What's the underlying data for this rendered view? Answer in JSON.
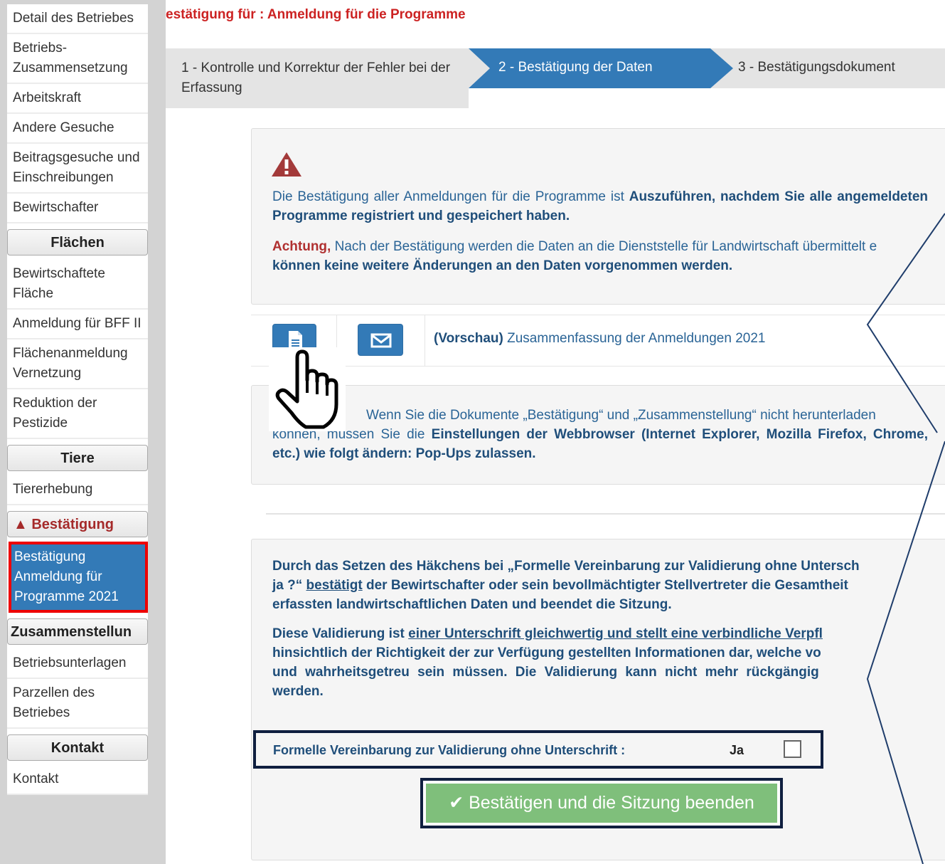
{
  "sidebar": {
    "items_top": [
      {
        "name": "nav-detail-des-betriebes",
        "label": "Detail des Betriebes"
      },
      {
        "name": "nav-betriebs-zusammensetzung",
        "label": "Betriebs-Zusammensetzung"
      },
      {
        "name": "nav-arbeitskraft",
        "label": "Arbeitskraft"
      },
      {
        "name": "nav-andere-gesuche",
        "label": "Andere Gesuche"
      },
      {
        "name": "nav-beitragsgesuche",
        "label": "Beitragsgesuche und Einschreibungen"
      },
      {
        "name": "nav-bewirtschafter",
        "label": "Bewirtschafter"
      }
    ],
    "section_flaechen": "Flächen",
    "items_flaechen": [
      {
        "name": "nav-bewirtschaftete-flaeche",
        "label": "Bewirtschaftete Fläche"
      },
      {
        "name": "nav-anmeldung-bff",
        "label": "Anmeldung für BFF II"
      },
      {
        "name": "nav-flaechenanmeldung",
        "label": "Flächenanmeldung Vernetzung"
      },
      {
        "name": "nav-reduktion-pestizide",
        "label": "Reduktion der Pestizide"
      }
    ],
    "section_tiere": "Tiere",
    "item_tiererhebung": "Tiererhebung",
    "section_bestaetigung": "Bestätigung",
    "item_active": "Bestätigung Anmeldung für Programme 2021",
    "section_zusammenstellung": "Zusammenstellun",
    "item_betriebsunterlagen": "Betriebsunterlagen",
    "item_parzellen": "Parzellen des Betriebes",
    "section_kontakt": "Kontakt",
    "item_kontakt": "Kontakt"
  },
  "header": {
    "title": "estätigung für : Anmeldung für die Programme"
  },
  "steps": {
    "step1": "1 - Kontrolle und Korrektur der Fehler bei der Erfassung",
    "step2": "2 - Bestätigung der Daten",
    "step3": "3 - Bestätigungsdokument"
  },
  "info": {
    "line1_normal": "Die Bestätigung aller Anmeldungen für die Programme ist ",
    "line1_bold": "Auszuführen, nachdem Sie alle angemeldeten Programme registriert und gespeichert haben.",
    "achtung": "Achtung,",
    "line2_normal": " Nach der Bestätigung werden die Daten an die Dienststelle für Landwirtschaft übermittelt e",
    "line2_bold": "können keine weitere Änderungen an den Daten vorgenommen werden."
  },
  "docs": {
    "preview_label": "(Vorschau)",
    "summary_label": " Zusammenfassung der Anmeldungen 2021"
  },
  "popup": {
    "text_normal": "Wenn Sie die Dokumente „Bestätigung“ und „Zusammenstellung“ nicht herunterladen",
    "text_line2_start": "können, müssen Sie die ",
    "text_bold": "Einstellungen der Webbrowser (Internet Explorer, Mozilla Firefox, Chrome, etc.) wie folgt ändern: Pop-Ups zulassen."
  },
  "validation": {
    "p1_a": "Durch das Setzen des Häkchens bei „Formelle Vereinbarung zur Validierung ohne Untersch",
    "p1_b": "ja ?“ ",
    "p1_underline": "bestätigt",
    "p1_c": " der Bewirtschafter oder sein bevollmächtigter Stellvertreter die Gesamtheit",
    "p1_d": "erfassten landwirtschaftlichen Daten und beendet die Sitzung.",
    "p2_a": "Diese Validierung ist ",
    "p2_underline": "einer Unterschrift gleichwertig und stellt eine verbindliche Verpfl",
    "p2_b": "hinsichtlich der Richtigkeit der zur Verfügung gestellten Informationen dar, welche vo",
    "p2_c": "und wahrheitsgetreu sein müssen. Die Validierung kann nicht mehr rückgängig",
    "p2_d": "werden.",
    "formel_label": "Formelle Vereinbarung zur Validierung ohne Unterschrift :",
    "ja_label": "Ja",
    "checkbox_checked": false,
    "confirm_button": "Bestätigen und die Sitzung beenden"
  }
}
